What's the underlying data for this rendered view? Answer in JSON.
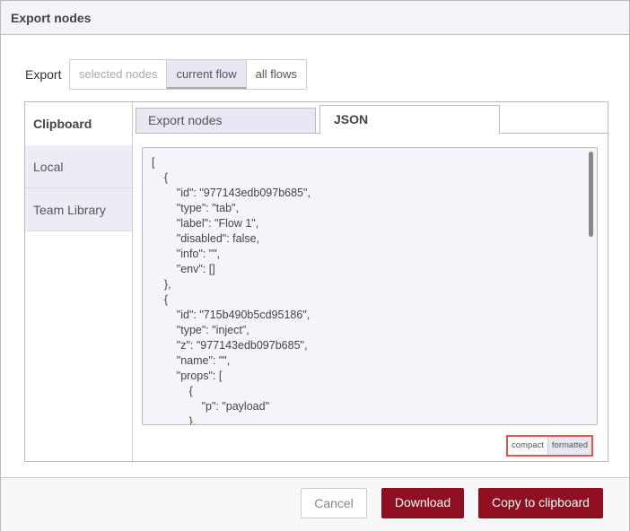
{
  "dialog": {
    "title": "Export nodes"
  },
  "export": {
    "label": "Export",
    "options": [
      "selected nodes",
      "current flow",
      "all flows"
    ],
    "selected": "current flow"
  },
  "sidebar": {
    "items": [
      {
        "label": "Clipboard"
      },
      {
        "label": "Local"
      },
      {
        "label": "Team Library"
      }
    ],
    "active": "Clipboard"
  },
  "tabs": [
    {
      "label": "Export nodes"
    },
    {
      "label": "JSON"
    }
  ],
  "active_tab": "JSON",
  "json_text": "[\n    {\n        \"id\": \"977143edb097b685\",\n        \"type\": \"tab\",\n        \"label\": \"Flow 1\",\n        \"disabled\": false,\n        \"info\": \"\",\n        \"env\": []\n    },\n    {\n        \"id\": \"715b490b5cd95186\",\n        \"type\": \"inject\",\n        \"z\": \"977143edb097b685\",\n        \"name\": \"\",\n        \"props\": [\n            {\n                \"p\": \"payload\"\n            },",
  "format": {
    "options": [
      "compact",
      "formatted"
    ],
    "selected": "formatted"
  },
  "footer": {
    "cancel": "Cancel",
    "download": "Download",
    "copy": "Copy to clipboard"
  },
  "colors": {
    "primary": "#8f0e1f",
    "highlight": "#e8554e"
  }
}
